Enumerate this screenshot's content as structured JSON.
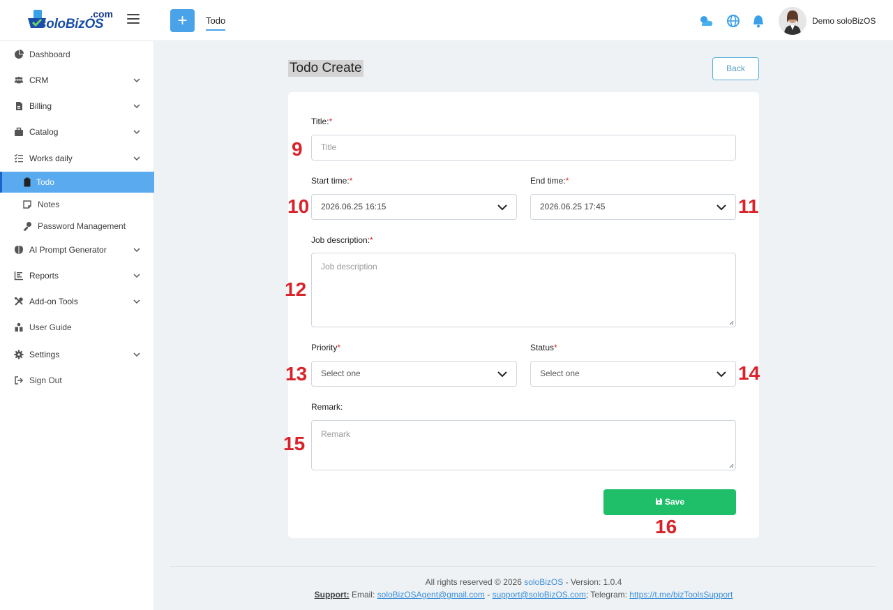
{
  "brand": {
    "name": "soloBizOS",
    "suffix": ".com"
  },
  "header": {
    "tab": "Todo",
    "add_label": "+",
    "username": "Demo soloBizOS",
    "icons": [
      "weather-icon",
      "globe-icon",
      "bell-icon"
    ]
  },
  "sidebar": {
    "items": [
      {
        "label": "Dashboard",
        "icon": "dashboard-icon",
        "chevron": false
      },
      {
        "label": "CRM",
        "icon": "users-icon",
        "chevron": true
      },
      {
        "label": "Billing",
        "icon": "billing-icon",
        "chevron": true
      },
      {
        "label": "Catalog",
        "icon": "catalog-icon",
        "chevron": true
      },
      {
        "label": "Works daily",
        "icon": "list-icon",
        "chevron": true
      },
      {
        "label": "Todo",
        "icon": "clipboard-icon",
        "active": true,
        "sub": true
      },
      {
        "label": "Notes",
        "icon": "note-icon",
        "sub": true
      },
      {
        "label": "Password Management",
        "icon": "key-icon",
        "sub": true
      },
      {
        "label": "AI Prompt Generator",
        "icon": "brain-icon",
        "chevron": true
      },
      {
        "label": "Reports",
        "icon": "report-icon",
        "chevron": true
      },
      {
        "label": "Add-on Tools",
        "icon": "tools-icon",
        "chevron": true
      },
      {
        "label": "User Guide",
        "icon": "guide-icon",
        "chevron": false
      },
      {
        "label": "Settings",
        "icon": "gear-icon",
        "chevron": true
      },
      {
        "label": "Sign Out",
        "icon": "signout-icon",
        "chevron": false
      }
    ]
  },
  "page": {
    "title": "Todo Create",
    "back_label": "Back"
  },
  "form": {
    "title_label": "Title:",
    "title_placeholder": "Title",
    "start_label": "Start time:",
    "start_value": "2026.06.25 16:15",
    "end_label": "End time:",
    "end_value": "2026.06.25 17:45",
    "desc_label": "Job description:",
    "desc_placeholder": "Job description",
    "priority_label": "Priority",
    "priority_value": "Select one",
    "status_label": "Status",
    "status_value": "Select one",
    "remark_label": "Remark:",
    "remark_placeholder": "Remark",
    "save_label": "Save",
    "required_mark": "*"
  },
  "annotations": [
    "9",
    "10",
    "11",
    "12",
    "13",
    "14",
    "15",
    "16"
  ],
  "footer": {
    "rights_prefix": "All rights reserved © 2026",
    "rights_brand": "soloBizOS",
    "rights_suffix": "- Version: 1.0.4",
    "support_label": "Support:",
    "email_label": "Email:",
    "email1": "soloBizOSAgent@gmail.com",
    "sep1": "-",
    "email2": "support@soloBizOS.com",
    "telegram_label": "; Telegram:",
    "telegram_link": "https://t.me/bizToolsSupport"
  }
}
